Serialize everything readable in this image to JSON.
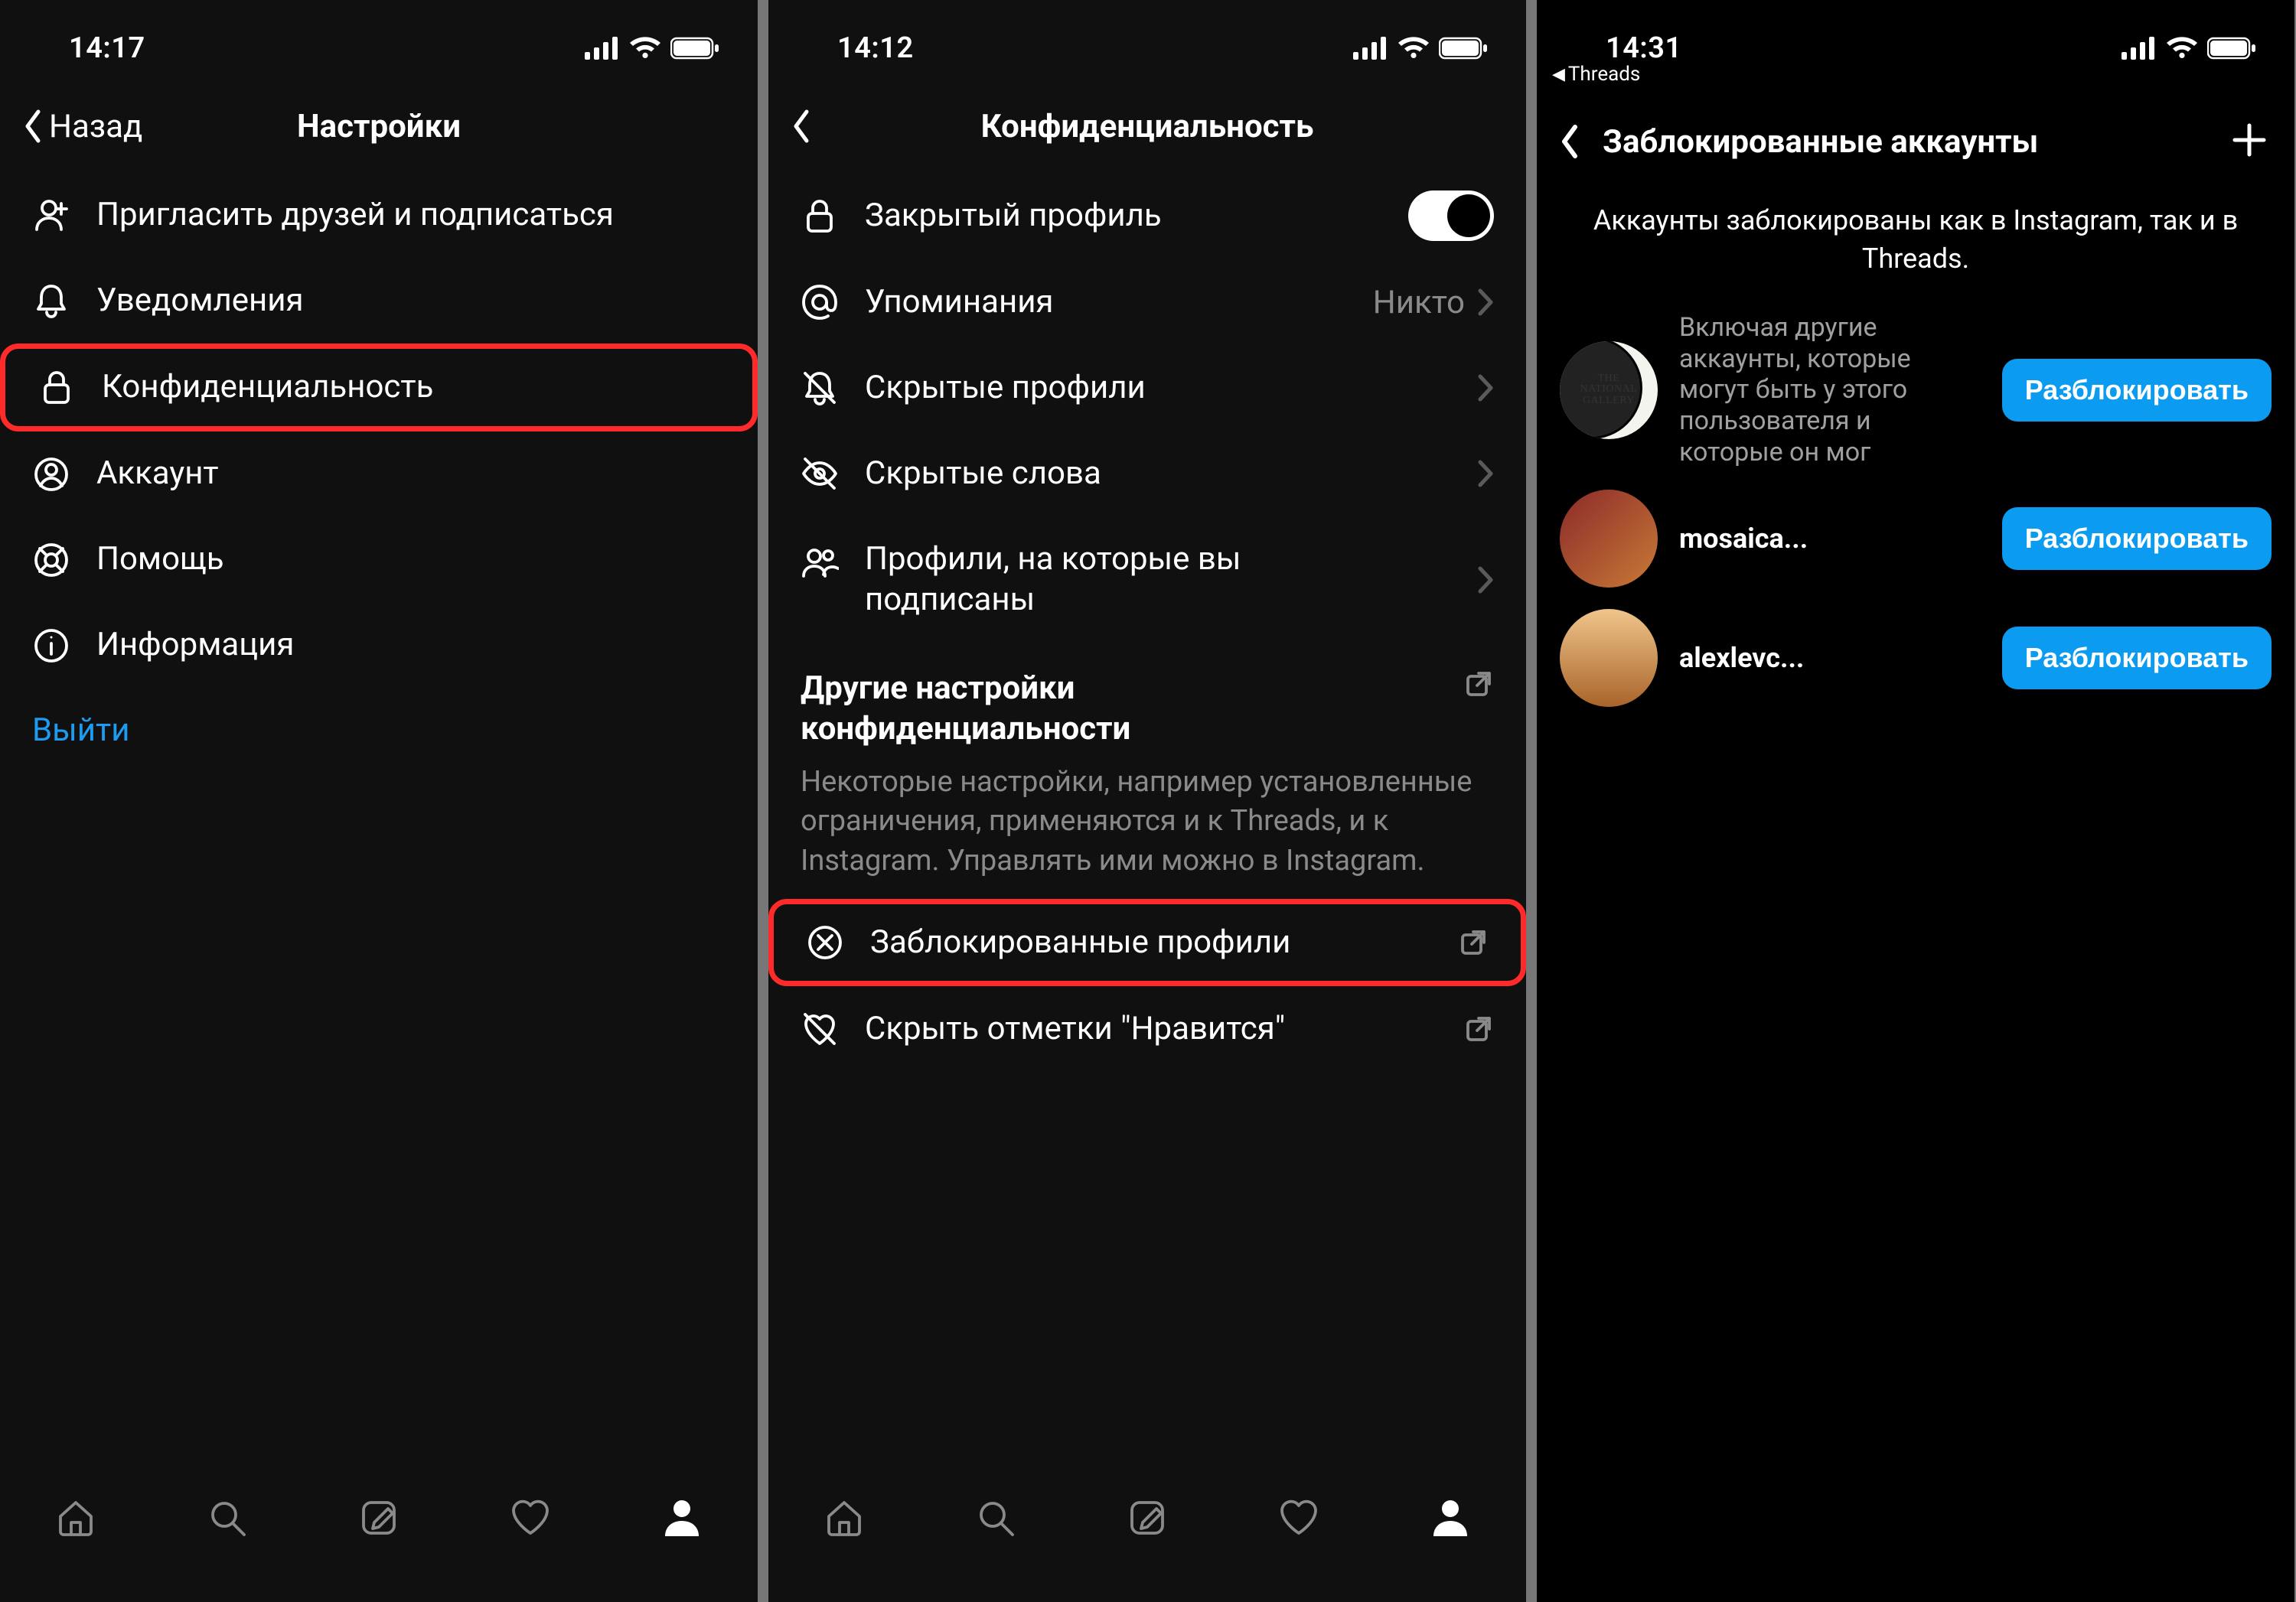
{
  "screen1": {
    "status": {
      "time": "14:17"
    },
    "nav": {
      "back_label": "Назад",
      "title": "Настройки"
    },
    "rows": [
      {
        "icon": "add-user",
        "label": "Пригласить друзей и подписаться"
      },
      {
        "icon": "bell",
        "label": "Уведомления"
      },
      {
        "icon": "lock",
        "label": "Конфиденциальность",
        "highlight": true
      },
      {
        "icon": "user-circle",
        "label": "Аккаунт"
      },
      {
        "icon": "lifebuoy",
        "label": "Помощь"
      },
      {
        "icon": "info",
        "label": "Информация"
      }
    ],
    "logout": "Выйти"
  },
  "screen2": {
    "status": {
      "time": "14:12"
    },
    "nav": {
      "title": "Конфиденциальность"
    },
    "rows_top": [
      {
        "icon": "lock",
        "label": "Закрытый профиль",
        "control": "toggle",
        "on": true
      },
      {
        "icon": "at",
        "label": "Упоминания",
        "value": "Никто",
        "right": "chevron"
      },
      {
        "icon": "bell-off",
        "label": "Скрытые профили",
        "right": "chevron"
      },
      {
        "icon": "eye-off",
        "label": "Скрытые слова",
        "right": "chevron"
      },
      {
        "icon": "users",
        "label": "Профили, на которые вы подписаны",
        "right": "chevron"
      }
    ],
    "section": {
      "title": "Другие настройки конфиденциальности",
      "desc": "Некоторые настройки, например установленные ограничения, применяются и к Threads, и к Instagram. Управлять ими можно в Instagram."
    },
    "rows_bottom": [
      {
        "icon": "x-circle",
        "label": "Заблокированные профили",
        "right": "external",
        "highlight": true
      },
      {
        "icon": "heart-off",
        "label": "Скрыть отметки \"Нравится\"",
        "right": "external"
      }
    ]
  },
  "screen3": {
    "status": {
      "time": "14:31",
      "back_app": "Threads"
    },
    "nav": {
      "title": "Заблокированные аккаунты"
    },
    "desc": "Аккаунты заблокированы как в Instagram, так и в Threads.",
    "accounts": [
      {
        "name_html": "THE NATIONAL GALLERY",
        "sub": "Включая другие аккаунты, которые могут быть у этого пользователя и которые он мог",
        "button": "Разблокировать",
        "avatar": "gallery"
      },
      {
        "name": "mosaica...",
        "button": "Разблокировать",
        "avatar": "mosaic"
      },
      {
        "name": "alexlevc...",
        "button": "Разблокировать",
        "avatar": "alex"
      }
    ]
  }
}
